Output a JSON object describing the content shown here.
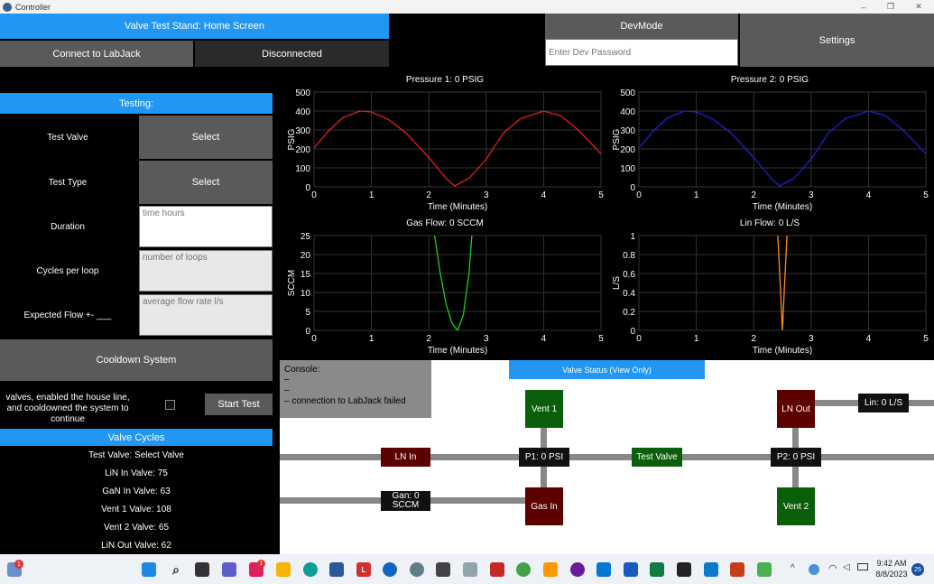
{
  "window": {
    "title": "Controller",
    "minimize": "–",
    "maximize": "❐",
    "close": "✕"
  },
  "header": {
    "title": "Valve Test Stand: Home Screen",
    "connect_button": "Connect to LabJack",
    "connection_status": "Disconnected",
    "devmode_button": "DevMode",
    "dev_password_placeholder": "Enter Dev Password",
    "settings_button": "Settings"
  },
  "testing": {
    "header": "Testing:",
    "test_valve_label": "Test Valve",
    "test_valve_button": "Select",
    "test_type_label": "Test Type",
    "test_type_button": "Select",
    "duration_label": "Duration",
    "duration_placeholder": "time hours",
    "cycles_label": "Cycles per loop",
    "cycles_placeholder": "number of loops",
    "flow_label": "Expected Flow +- ___",
    "flow_placeholder": "average flow rate l/s",
    "cooldown_button": "Cooldown System",
    "instructions": "valves, enabled the house line, and cooldowned the system to continue",
    "start_button": "Start Test"
  },
  "valve_cycles": {
    "header": "Valve Cycles",
    "lines": [
      "Test Valve: Select Valve",
      "LiN In Valve: 75",
      "GaN In Valve: 63",
      "Vent 1 Valve: 108",
      "Vent 2 Valve: 65",
      "LiN Out Valve: 62"
    ]
  },
  "chart_data": [
    {
      "type": "line",
      "title": "Pressure 1: 0 PSIG",
      "xlabel": "Time (Minutes)",
      "ylabel": "PSIG",
      "xlim": [
        0,
        5
      ],
      "ylim": [
        0,
        500
      ],
      "xticks": [
        "0",
        "1",
        "2",
        "3",
        "4",
        "5"
      ],
      "yticks": [
        "0",
        "100",
        "200",
        "300",
        "400",
        "500"
      ],
      "grid": true,
      "x": [
        0,
        0.25,
        0.5,
        0.8,
        1.0,
        1.3,
        1.6,
        2.0,
        2.3,
        2.45,
        2.7,
        3.0,
        3.3,
        3.6,
        4.0,
        4.3,
        4.6,
        5.0
      ],
      "series": [
        {
          "color": "#e02020",
          "values": [
            205,
            295,
            365,
            400,
            395,
            355,
            285,
            155,
            45,
            5,
            45,
            145,
            285,
            360,
            400,
            375,
            300,
            175
          ]
        }
      ]
    },
    {
      "type": "line",
      "title": "Pressure 2: 0 PSIG",
      "xlabel": "Time (Minutes)",
      "ylabel": "PSIG",
      "xlim": [
        0,
        5
      ],
      "ylim": [
        0,
        500
      ],
      "xticks": [
        "0",
        "1",
        "2",
        "3",
        "4",
        "5"
      ],
      "yticks": [
        "0",
        "100",
        "200",
        "300",
        "400",
        "500"
      ],
      "grid": true,
      "x": [
        0,
        0.25,
        0.5,
        0.8,
        1.0,
        1.3,
        1.6,
        2.0,
        2.3,
        2.45,
        2.7,
        3.0,
        3.3,
        3.6,
        4.0,
        4.3,
        4.6,
        5.0
      ],
      "series": [
        {
          "color": "#2020d0",
          "values": [
            205,
            295,
            365,
            400,
            395,
            355,
            285,
            155,
            45,
            5,
            45,
            145,
            285,
            360,
            400,
            375,
            300,
            175
          ]
        }
      ]
    },
    {
      "type": "line",
      "title": "Gas Flow: 0 SCCM",
      "xlabel": "Time (Minutes)",
      "ylabel": "SCCM",
      "xlim": [
        0,
        5
      ],
      "ylim": [
        0,
        25
      ],
      "xticks": [
        "0",
        "1",
        "2",
        "3",
        "4",
        "5"
      ],
      "yticks": [
        "0",
        "5",
        "10",
        "15",
        "20",
        "25"
      ],
      "grid": true,
      "x": [
        2.1,
        2.2,
        2.3,
        2.4,
        2.5,
        2.6,
        2.7,
        2.75
      ],
      "series": [
        {
          "color": "#22cc22",
          "values": [
            25,
            15,
            7,
            2,
            0,
            4,
            15,
            25
          ]
        }
      ]
    },
    {
      "type": "line",
      "title": "Lin Flow: 0 L/S",
      "xlabel": "Time (Minutes)",
      "ylabel": "L/S",
      "xlim": [
        0,
        5
      ],
      "ylim": [
        0,
        1
      ],
      "xticks": [
        "0",
        "1",
        "2",
        "3",
        "4",
        "5"
      ],
      "yticks": [
        "0",
        "0.2",
        "0.4",
        "0.6",
        "0.8",
        "1"
      ],
      "grid": true,
      "x": [
        2.42,
        2.46,
        2.5,
        2.54,
        2.58
      ],
      "series": [
        {
          "color": "#ff8c1a",
          "values": [
            1,
            0.5,
            0,
            0.5,
            1
          ]
        }
      ]
    }
  ],
  "console": {
    "title": "Console:",
    "lines": [
      "–",
      "–",
      "– connection to LabJack failed"
    ]
  },
  "diagram": {
    "header": "Valve Status (View Only)",
    "vent1": "Vent 1",
    "ln_out": "LN Out",
    "lin_readout": "Lin: 0 L/S",
    "ln_in": "LN In",
    "p1": "P1: 0 PSI",
    "test_valve": "Test Valve",
    "p2": "P2: 0 PSI",
    "gan_readout": "Gan: 0 SCCM",
    "gas_in": "Gas In",
    "vent2": "Vent 2"
  },
  "taskbar": {
    "time": "9:42 AM",
    "date": "8/8/2023",
    "notification_badge": "1",
    "chat_badge": "1",
    "tray_badge": "25"
  },
  "colors": {
    "accent_blue": "#2196f3",
    "valve_closed": "#5c0000",
    "valve_open": "#0b5f0b"
  }
}
